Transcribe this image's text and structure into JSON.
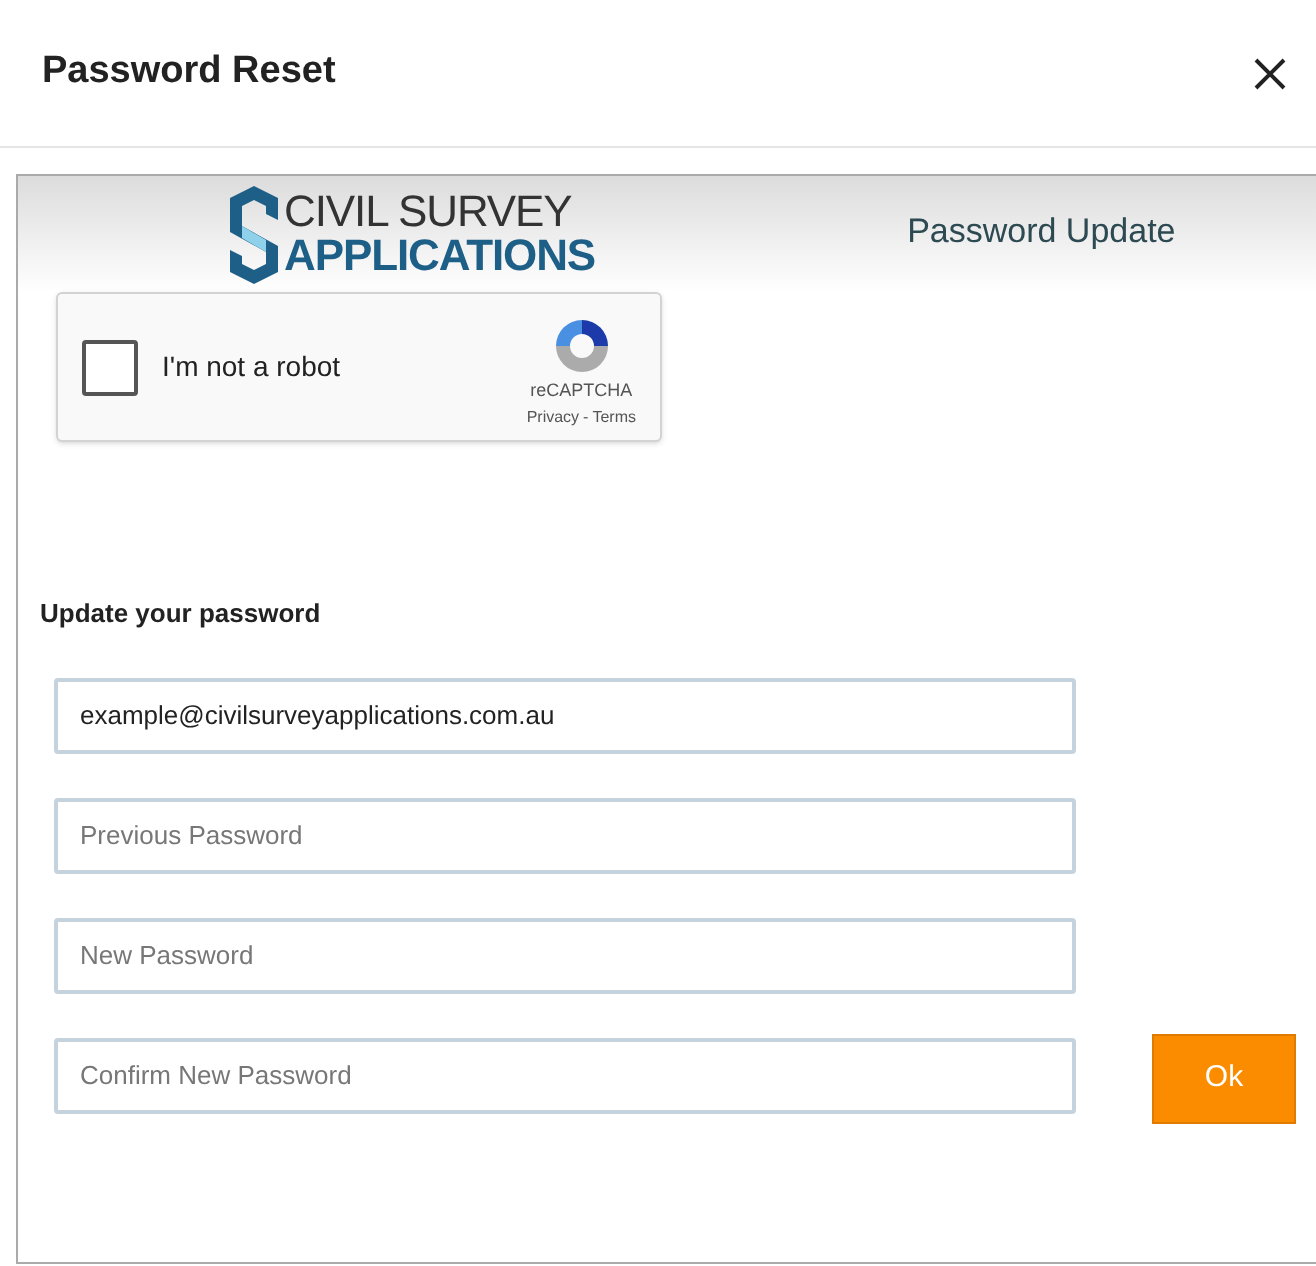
{
  "dialog": {
    "title": "Password Reset"
  },
  "banner": {
    "logo_line_1": "CIVIL SURVEY",
    "logo_line_2": "APPLICATIONS",
    "heading": "Password Update"
  },
  "recaptcha": {
    "label": "I'm not a robot",
    "checked": false,
    "brand": "reCAPTCHA",
    "links": [
      "Privacy",
      "Terms"
    ],
    "separator": "-"
  },
  "form": {
    "heading": "Update your password",
    "fields": [
      {
        "value": "example@civilsurveyapplications.com.au"
      },
      {
        "placeholder": "Previous Password"
      },
      {
        "placeholder": "New Password"
      },
      {
        "placeholder": "Confirm New Password"
      }
    ],
    "button": "Ok"
  }
}
